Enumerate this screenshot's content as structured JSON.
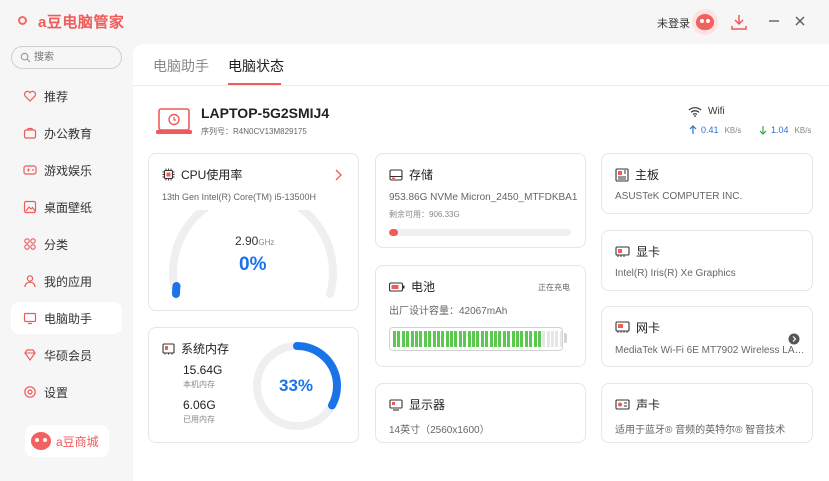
{
  "app": {
    "title": "a豆电脑管家",
    "login_text": "未登录"
  },
  "search": {
    "placeholder": "搜索"
  },
  "sidebar": {
    "items": [
      {
        "label": "推荐",
        "icon": "heart-icon"
      },
      {
        "label": "办公教育",
        "icon": "briefcase-icon"
      },
      {
        "label": "游戏娱乐",
        "icon": "gamepad-icon"
      },
      {
        "label": "桌面壁纸",
        "icon": "image-icon"
      },
      {
        "label": "分类",
        "icon": "grid-icon"
      },
      {
        "label": "我的应用",
        "icon": "user-icon"
      },
      {
        "label": "电脑助手",
        "icon": "monitor-icon",
        "active": true
      },
      {
        "label": "华硕会员",
        "icon": "diamond-icon"
      },
      {
        "label": "设置",
        "icon": "settings-icon"
      }
    ],
    "shop_label": "a豆商城"
  },
  "tabs": [
    {
      "label": "电脑助手"
    },
    {
      "label": "电脑状态",
      "active": true
    }
  ],
  "device": {
    "name": "LAPTOP-5G2SMIJ4",
    "serial": "序列号：R4N0CV13M829175"
  },
  "network": {
    "label": "Wifi",
    "up_value": "0.41",
    "up_unit": "KB/s",
    "down_value": "1.04",
    "down_unit": "KB/s"
  },
  "cpu": {
    "title": "CPU使用率",
    "model": "13th Gen Intel(R) Core(TM) i5-13500H",
    "freq": "2.90",
    "freq_unit": "GHz",
    "usage": "0%"
  },
  "memory": {
    "title": "系统内存",
    "total": "15.64G",
    "total_label": "本机内存",
    "used": "6.06G",
    "used_label": "已用内存",
    "percent": "33%",
    "fraction": 0.33
  },
  "storage": {
    "title": "存储",
    "model": "953.86G  NVMe Micron_2450_MTFDKBA1T0",
    "free": "剩余可用：906.33G",
    "used_fraction": 0.05
  },
  "battery": {
    "title": "电池",
    "status": "正在充电",
    "capacity": "出厂设计容量：42067mAh",
    "level": 0.86
  },
  "display": {
    "title": "显示器",
    "spec": "14英寸（2560x1600）"
  },
  "motherboard": {
    "title": "主板",
    "name": "ASUSTeK COMPUTER INC."
  },
  "gpu": {
    "title": "显卡",
    "name": "Intel(R) Iris(R) Xe Graphics"
  },
  "nic": {
    "title": "网卡",
    "name": "MediaTek Wi-Fi 6E MT7902 Wireless LAN..."
  },
  "sound": {
    "title": "声卡",
    "name": "适用于蓝牙® 音频的英特尔® 智音技术"
  },
  "colors": {
    "accent": "#ef5a5a",
    "blue": "#1a73e8",
    "green": "#5bc94f"
  }
}
